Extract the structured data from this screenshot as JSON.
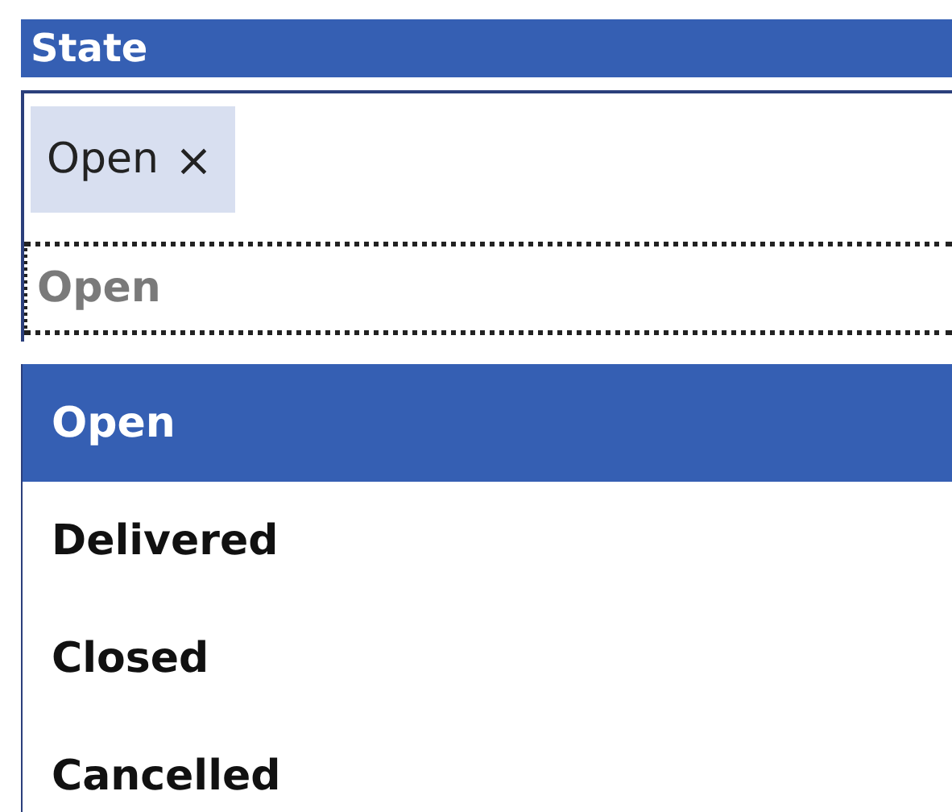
{
  "header": {
    "title": "State"
  },
  "selected_tags": [
    {
      "label": "Open",
      "remove": "×"
    }
  ],
  "search": {
    "placeholder": "Open"
  },
  "options": [
    {
      "label": "Open",
      "selected": true
    },
    {
      "label": "Delivered",
      "selected": false
    },
    {
      "label": "Closed",
      "selected": false
    },
    {
      "label": "Cancelled",
      "selected": false
    }
  ]
}
